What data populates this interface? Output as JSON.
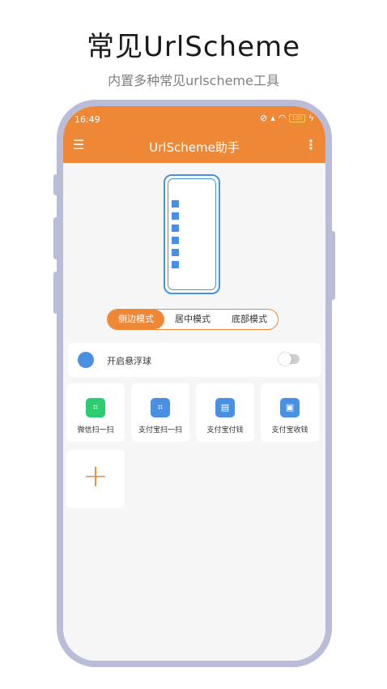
{
  "promo": {
    "title": "常见UrlScheme",
    "subtitle": "内置多种常见urlscheme工具"
  },
  "status_bar": {
    "time": "16:49",
    "battery": "100"
  },
  "app_bar": {
    "title": "UrlScheme助手",
    "menu_icon": "hamburger-icon",
    "more_icon": "vertical-dots-icon"
  },
  "mode_selector": {
    "options": [
      "侧边模式",
      "居中模式",
      "底部模式"
    ],
    "selected": "侧边模式"
  },
  "floating_ball": {
    "label": "开启悬浮球",
    "enabled": false
  },
  "shortcuts": [
    {
      "label": "微信扫一扫",
      "icon": "wechat-scan-icon",
      "color": "#2ecc71"
    },
    {
      "label": "支付宝扫一扫",
      "icon": "alipay-scan-icon",
      "color": "#4a90e2"
    },
    {
      "label": "支付宝付钱",
      "icon": "alipay-pay-icon",
      "color": "#4a90e2"
    },
    {
      "label": "支付宝收钱",
      "icon": "alipay-receive-icon",
      "color": "#4a90e2"
    }
  ],
  "add_tile_icon": "plus-icon",
  "colors": {
    "accent": "#ef8836",
    "blue": "#4a90e2",
    "frame": "#b9bdd8"
  }
}
